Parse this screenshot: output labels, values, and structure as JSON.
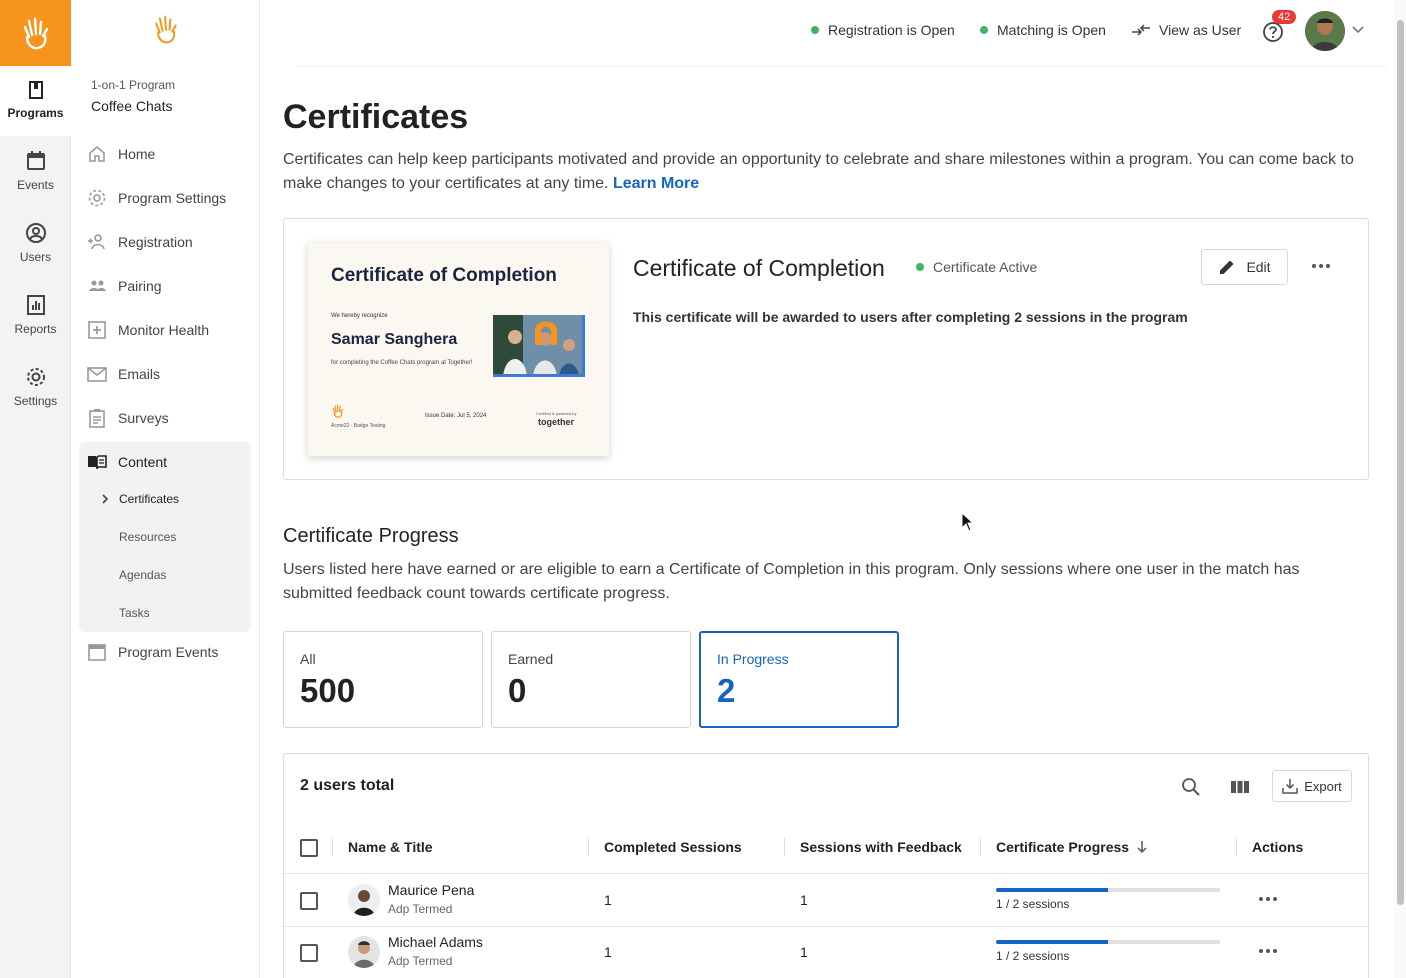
{
  "topbar": {
    "registration_status": "Registration is Open",
    "matching_status": "Matching is Open",
    "view_as_user": "View as User",
    "help_badge": "42",
    "status_color": "#3fb55f"
  },
  "rail": {
    "items": [
      {
        "label": "Programs",
        "icon": "book-icon"
      },
      {
        "label": "Events",
        "icon": "calendar-icon"
      },
      {
        "label": "Users",
        "icon": "user-circle-icon"
      },
      {
        "label": "Reports",
        "icon": "chart-icon"
      },
      {
        "label": "Settings",
        "icon": "gear-icon"
      }
    ]
  },
  "sidebar": {
    "program_type": "1-on-1 Program",
    "program_name": "Coffee Chats",
    "items": [
      {
        "label": "Home",
        "icon": "home-icon"
      },
      {
        "label": "Program Settings",
        "icon": "gear-icon"
      },
      {
        "label": "Registration",
        "icon": "add-user-icon"
      },
      {
        "label": "Pairing",
        "icon": "people-icon"
      },
      {
        "label": "Monitor Health",
        "icon": "health-icon"
      },
      {
        "label": "Emails",
        "icon": "mail-icon"
      },
      {
        "label": "Surveys",
        "icon": "clipboard-icon"
      },
      {
        "label": "Content",
        "icon": "open-book-icon"
      },
      {
        "label": "Program Events",
        "icon": "calendar-icon"
      }
    ],
    "content_sub": [
      "Certificates",
      "Resources",
      "Agendas",
      "Tasks"
    ]
  },
  "page": {
    "title": "Certificates",
    "description": "Certificates can help keep participants motivated and provide an opportunity to celebrate and share milestones within a program. You can come back to make changes to your certificates at any time.",
    "learn_more": "Learn More"
  },
  "certificate": {
    "name": "Certificate of Completion",
    "status": "Certificate Active",
    "edit_label": "Edit",
    "description": "This certificate will be awarded to users after completing 2 sessions in the program",
    "preview": {
      "title": "Certificate of Completion",
      "recognize": "We hereby recognize",
      "recipient": "Samar Sanghera",
      "for_text": "for completing the Coffee Chats program at Together!",
      "footer_left": "Acme22 - Badge Testing",
      "issue_date": "Issue Date: Jul 5, 2024",
      "ack": "Certified & powered by",
      "brand": "together"
    }
  },
  "progress": {
    "title": "Certificate Progress",
    "description": "Users listed here have earned or are eligible to earn a Certificate of Completion in this program. Only sessions where one user in the match has submitted feedback count towards certificate progress.",
    "stats": [
      {
        "label": "All",
        "value": "500"
      },
      {
        "label": "Earned",
        "value": "0"
      },
      {
        "label": "In Progress",
        "value": "2"
      }
    ]
  },
  "table": {
    "total": "2 users total",
    "export_label": "Export",
    "columns": [
      "Name & Title",
      "Completed Sessions",
      "Sessions with Feedback",
      "Certificate Progress",
      "Actions"
    ],
    "rows": [
      {
        "name": "Maurice Pena",
        "title": "Adp Termed",
        "completed": "1",
        "feedback": "1",
        "progress_label": "1 / 2 sessions",
        "progress": 0.5
      },
      {
        "name": "Michael Adams",
        "title": "Adp Termed",
        "completed": "1",
        "feedback": "1",
        "progress_label": "1 / 2 sessions",
        "progress": 0.5
      }
    ]
  },
  "colors": {
    "brand_orange": "#f7941d",
    "accent_blue": "#1565c0"
  }
}
